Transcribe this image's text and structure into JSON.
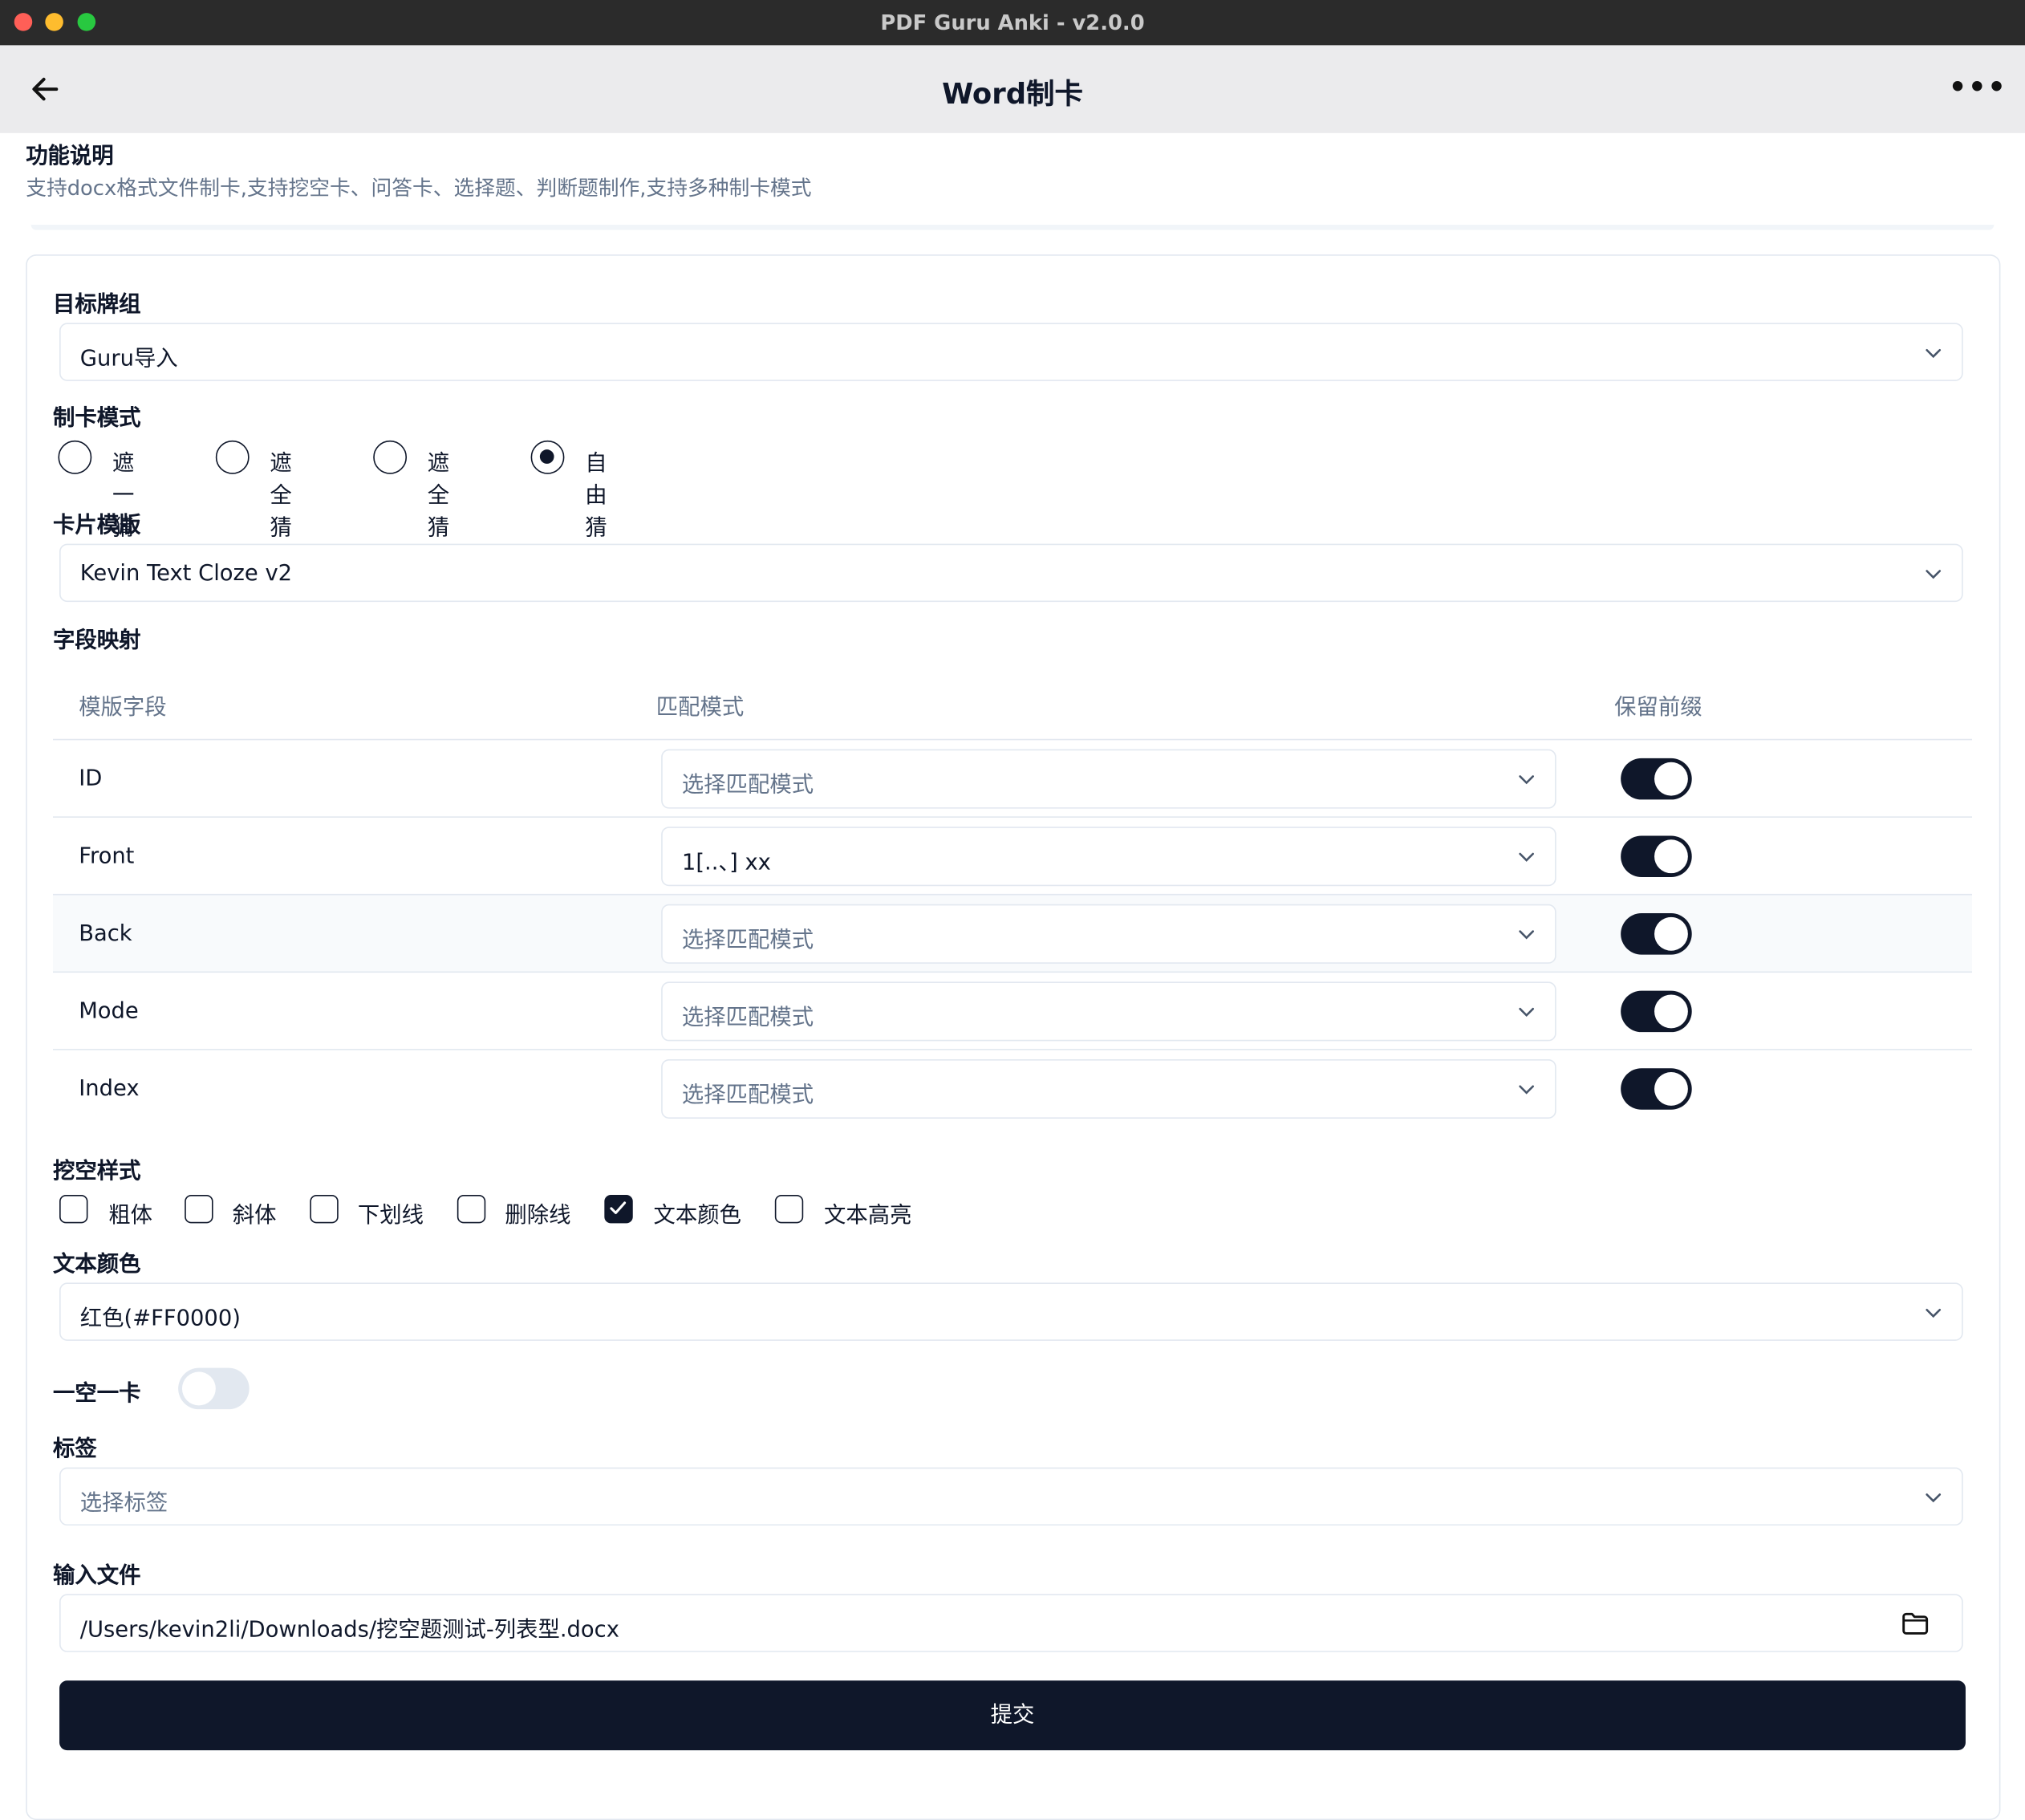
{
  "window": {
    "title": "PDF Guru Anki - v2.0.0"
  },
  "header": {
    "title": "Word制卡",
    "more": "•••"
  },
  "description": {
    "title": "功能说明",
    "text": "支持docx格式文件制卡,支持挖空卡、问答卡、选择题、判断题制作,支持多种制卡模式"
  },
  "deck": {
    "label": "目标牌组",
    "value": "Guru导入"
  },
  "mode": {
    "label": "制卡模式",
    "options": [
      "遮一猜一",
      "遮全猜一",
      "遮全猜全",
      "自由猜"
    ],
    "selected": "自由猜"
  },
  "template": {
    "label": "卡片模版",
    "value": "Kevin Text Cloze v2"
  },
  "mapping": {
    "label": "字段映射",
    "headers": [
      "模版字段",
      "匹配模式",
      "保留前缀"
    ],
    "rows": [
      {
        "field": "ID",
        "match": "选择匹配模式",
        "keep_prefix": true
      },
      {
        "field": "Front",
        "match": "1[..、] xx",
        "keep_prefix": true
      },
      {
        "field": "Back",
        "match": "选择匹配模式",
        "keep_prefix": true
      },
      {
        "field": "Mode",
        "match": "选择匹配模式",
        "keep_prefix": true
      },
      {
        "field": "Index",
        "match": "选择匹配模式",
        "keep_prefix": true
      }
    ]
  },
  "cloze_style": {
    "label": "挖空样式",
    "options": [
      {
        "label": "粗体",
        "checked": false
      },
      {
        "label": "斜体",
        "checked": false
      },
      {
        "label": "下划线",
        "checked": false
      },
      {
        "label": "删除线",
        "checked": false
      },
      {
        "label": "文本颜色",
        "checked": true
      },
      {
        "label": "文本高亮",
        "checked": false
      }
    ]
  },
  "text_color": {
    "label": "文本颜色",
    "value": "红色(#FF0000)"
  },
  "one_per_card": {
    "label": "一空一卡",
    "on": false
  },
  "tags": {
    "label": "标签",
    "placeholder": "选择标签"
  },
  "input_file": {
    "label": "输入文件",
    "value": "/Users/kevin2li/Downloads/挖空题测试-列表型.docx"
  },
  "submit": {
    "label": "提交"
  },
  "colors": {
    "primary": "#0f172a",
    "muted": "#64748b",
    "border": "#e2e8f0"
  }
}
